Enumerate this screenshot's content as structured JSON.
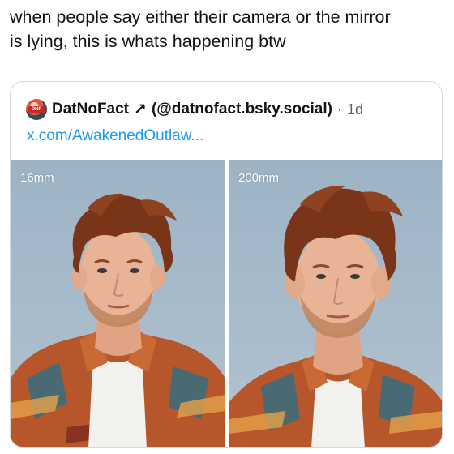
{
  "post": {
    "text": "when people say either their camera or the mirror\nis lying, this is whats happening btw"
  },
  "quote": {
    "display_name": "DatNoFact",
    "arrow": "↗",
    "handle": "(@datnofact.bsky.social)",
    "separator": "·",
    "time": "1d",
    "link_text": "x.com/AwakenedOutlaw...",
    "avatar_badge": "DNF",
    "images": [
      {
        "label": "16mm",
        "icon": "portrait-photo"
      },
      {
        "label": "200mm",
        "icon": "portrait-photo"
      }
    ]
  },
  "colors": {
    "link": "#1d9bf0",
    "secondary_text": "#536471",
    "border": "#cfd9de"
  }
}
